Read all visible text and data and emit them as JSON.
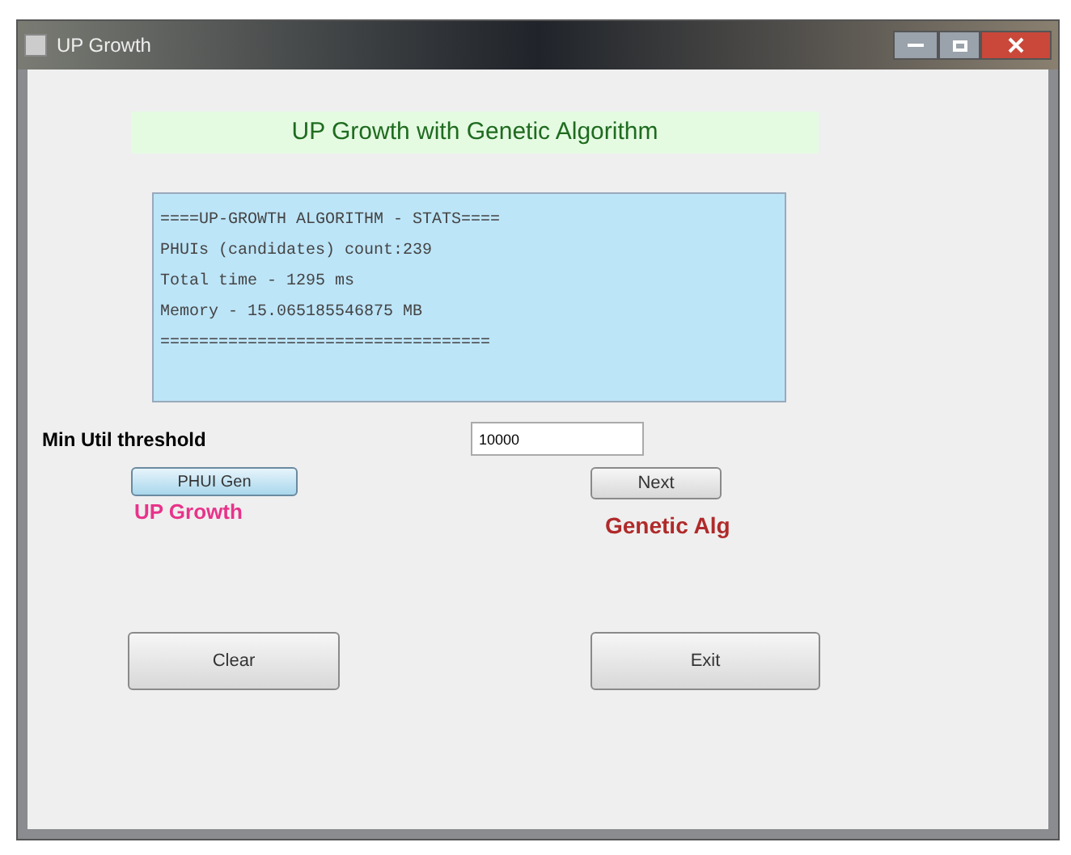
{
  "window": {
    "title": "UP Growth"
  },
  "heading": "UP Growth with Genetic Algorithm",
  "stats_lines": [
    "====UP-GROWTH ALGORITHM - STATS====",
    "PHUIs (candidates) count:239",
    "Total time - 1295 ms",
    "Memory - 15.065185546875 MB",
    "=================================="
  ],
  "threshold": {
    "label": "Min Util threshold",
    "value": "10000"
  },
  "phui_button": "PHUI Gen",
  "up_growth_label": "UP Growth",
  "next_button": "Next",
  "genetic_label": "Genetic Alg",
  "buttons": [
    "Clear",
    "Exit"
  ]
}
